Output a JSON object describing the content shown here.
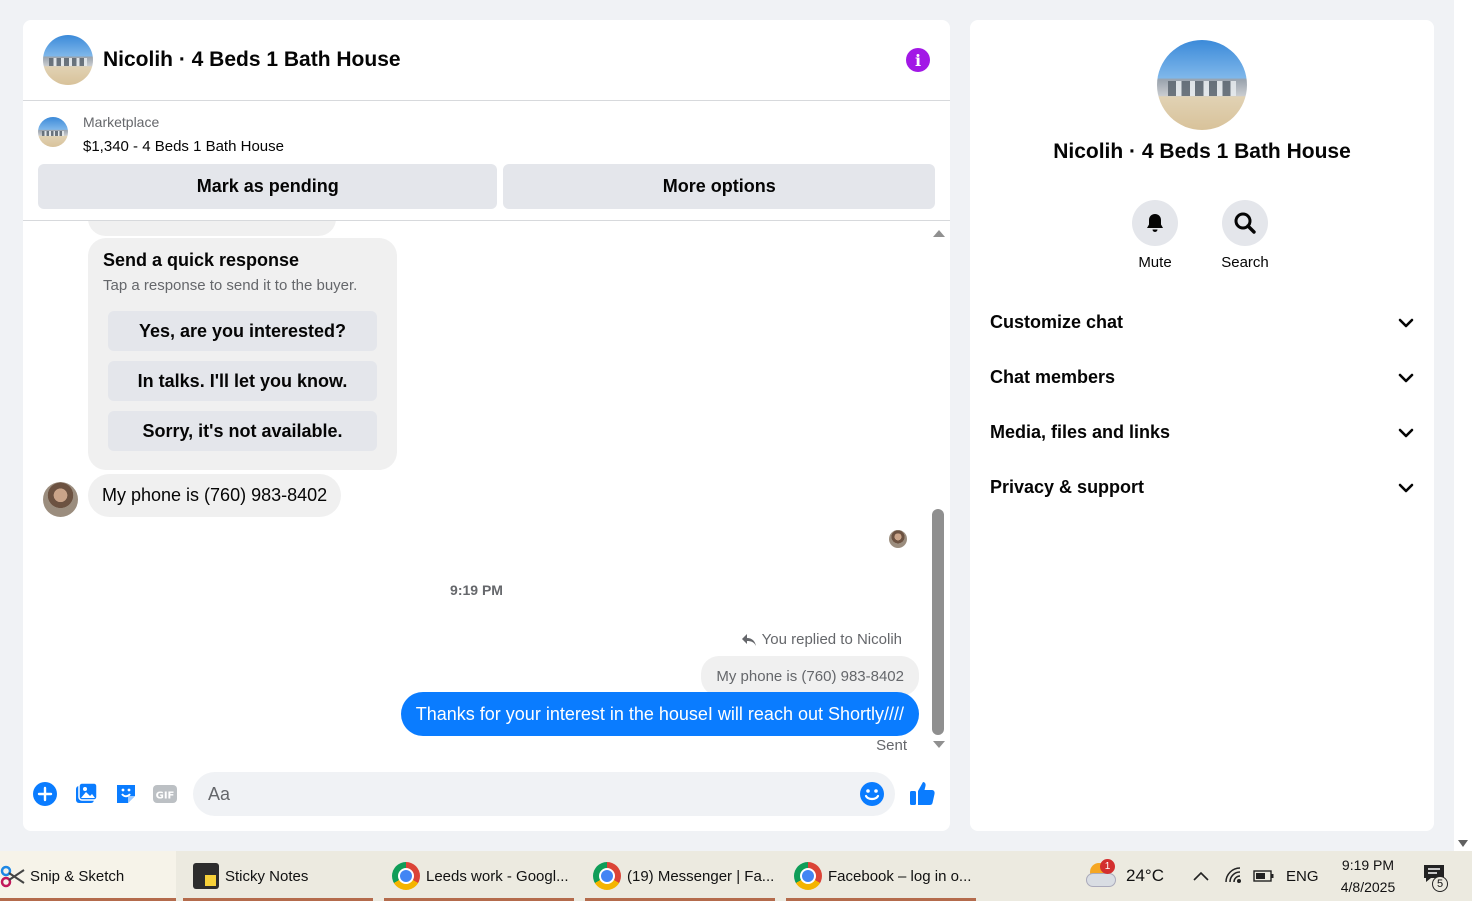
{
  "chat": {
    "title": "Nicolih · 4 Beds 1 Bath House",
    "listing": {
      "source": "Marketplace",
      "price_title": "$1,340 - 4 Beds 1 Bath House",
      "mark_pending": "Mark as pending",
      "more_options": "More options"
    },
    "quick_response": {
      "title": "Send a quick response",
      "subtitle": "Tap a response to send it to the buyer.",
      "options": [
        "Yes, are you interested?",
        "In talks. I'll let you know.",
        "Sorry, it's not available."
      ]
    },
    "incoming_message": "My phone is (760) 983-8402",
    "timestamp": "9:19 PM",
    "replied_label": "You replied to Nicolih",
    "quoted_message": "My phone is (760) 983-8402",
    "sent_message": "Thanks for your interest in the houseI will reach out Shortly////",
    "sent_status": "Sent",
    "composer_placeholder": "Aa"
  },
  "sidebar": {
    "title": "Nicolih · 4 Beds 1 Bath House",
    "actions": [
      {
        "label": "Mute",
        "icon": "bell-icon"
      },
      {
        "label": "Search",
        "icon": "search-icon"
      }
    ],
    "sections": [
      "Customize chat",
      "Chat members",
      "Media, files and links",
      "Privacy & support"
    ]
  },
  "taskbar": {
    "apps": [
      "Snip & Sketch",
      "Sticky Notes",
      "Leeds work - Googl...",
      "(19) Messenger | Fa...",
      "Facebook – log in o..."
    ],
    "weather": "24°C",
    "weather_badge": "1",
    "language": "ENG",
    "time": "9:19 PM",
    "date": "4/8/2025",
    "notifications": "5"
  },
  "colors": {
    "accent": "#0a7cff",
    "info": "#a218e6",
    "bubble": "#f0f0f0",
    "button": "#e4e6eb"
  }
}
